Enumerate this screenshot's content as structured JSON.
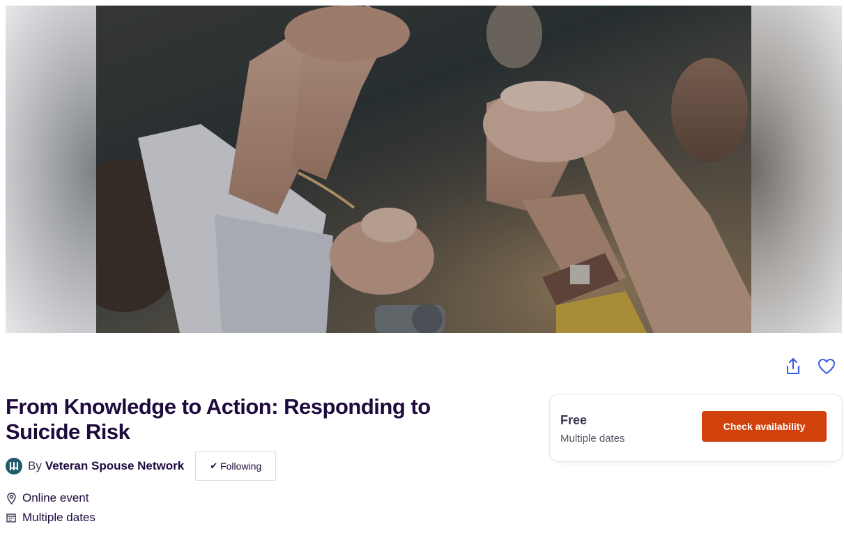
{
  "hero": {
    "image_name": "hands-joined-raised-photo"
  },
  "actions": {
    "share_icon": "share-icon",
    "like_icon": "heart-icon"
  },
  "event": {
    "title": "From Knowledge to Action: Responding to Suicide Risk",
    "location": "Online event",
    "dates": "Multiple dates"
  },
  "organizer": {
    "by_label": "By",
    "name": "Veteran Spouse Network",
    "follow_label": "Following"
  },
  "ticket": {
    "price": "Free",
    "dates": "Multiple dates",
    "cta_label": "Check availability"
  },
  "colors": {
    "brand_cta": "#d1410c",
    "title_text": "#1e0a3c",
    "icon_accent": "#3659e3"
  }
}
